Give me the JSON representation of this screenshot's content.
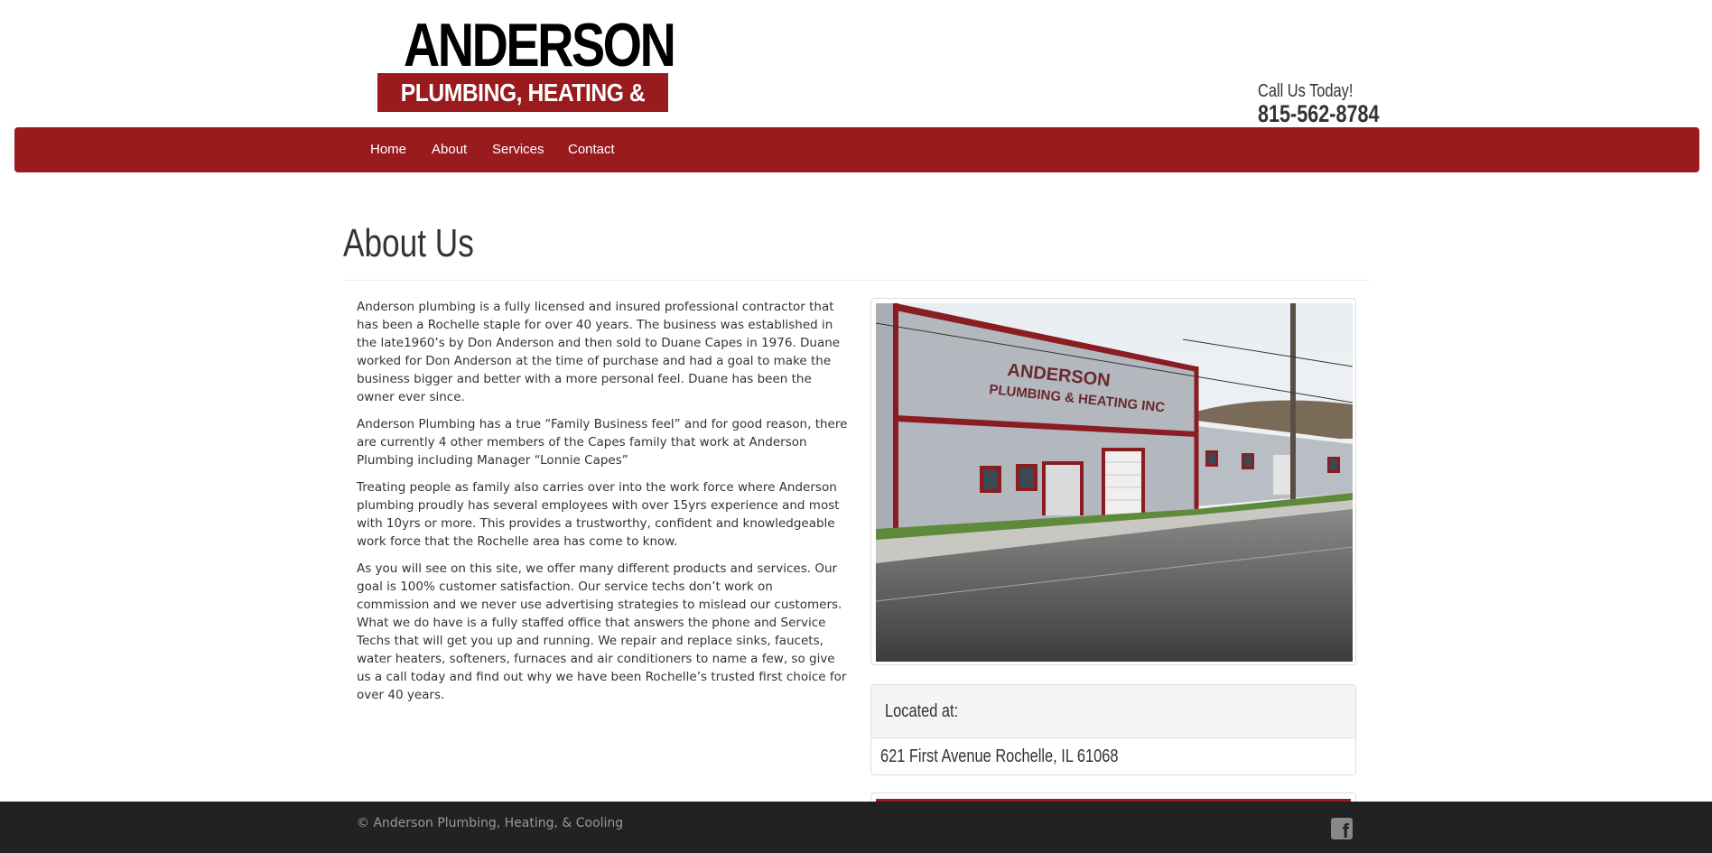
{
  "header": {
    "logo_top": "ANDERSON",
    "logo_bottom": "PLUMBING, HEATING & COOLING",
    "call_label": "Call Us Today!",
    "phone": "815-562-8784"
  },
  "nav": {
    "items": [
      {
        "label": "Home"
      },
      {
        "label": "About"
      },
      {
        "label": "Services"
      },
      {
        "label": "Contact"
      }
    ]
  },
  "page": {
    "title": "About Us",
    "paragraphs": [
      "Anderson plumbing is a fully licensed and insured professional contractor that has been a Rochelle staple for over 40 years. The business was established in the late1960’s by Don Anderson and then sold to Duane Capes in 1976. Duane worked for Don Anderson at the time of purchase and had a goal to make the business bigger and better with a more personal feel. Duane has been the owner ever since.",
      "Anderson Plumbing has a true “Family Business feel” and for good reason, there are currently 4 other members of the Capes family that work at Anderson Plumbing including Manager “Lonnie Capes”",
      "Treating people as family also carries over into the work force where Anderson plumbing proudly has several employees with over 15yrs experience and most with 10yrs or more. This provides a trustworthy, confident and knowledgeable work force that the Rochelle area has come to know.",
      "As you will see on this site, we offer many different products and services. Our goal is 100% customer satisfaction. Our service techs don’t work on commission and we never use advertising strategies to mislead our customers. What we do have is a fully staffed office that answers the phone and Service Techs that will get you up and running. We repair and replace sinks, faucets, water heaters, softeners, furnaces and air conditioners to name a few, so give us a call today and find out why we have been Rochelle’s trusted first choice for over 40 years."
    ]
  },
  "photo": {
    "sign_line1": "ANDERSON",
    "sign_line2": "PLUMBING & HEATING INC"
  },
  "location": {
    "title": "Located at:",
    "address": "621 First Avenue Rochelle, IL 61068"
  },
  "footer": {
    "copyright": "© Anderson Plumbing, Heating, & Cooling",
    "social_icon": "facebook-icon"
  },
  "colors": {
    "brand_red": "#9a1b1e",
    "footer_bg": "#222222"
  }
}
